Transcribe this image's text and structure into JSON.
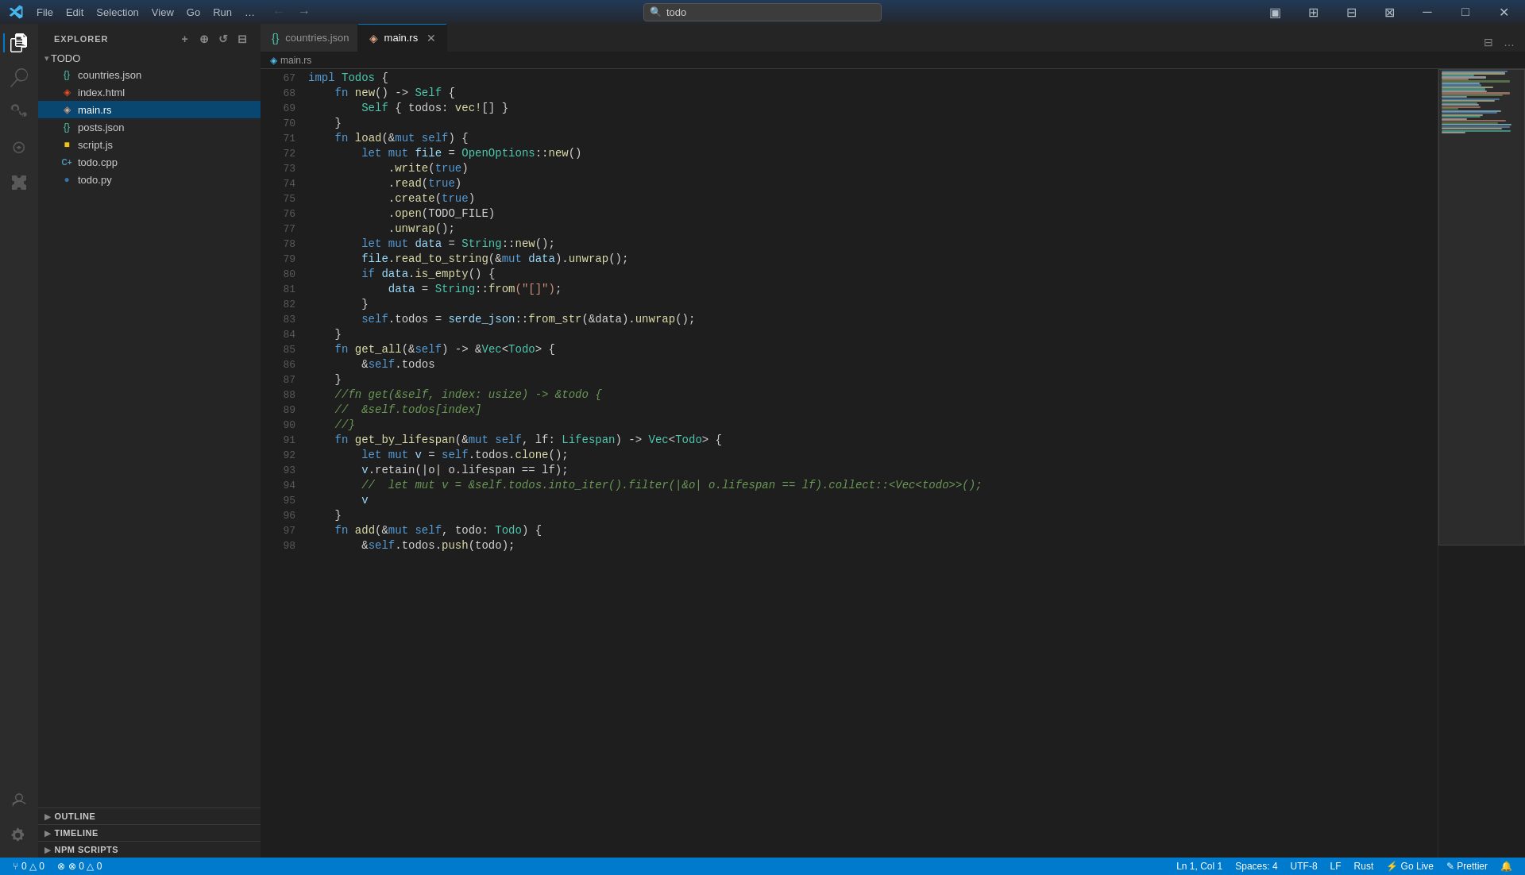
{
  "titlebar": {
    "logo_icon": "◈",
    "menu_items": [
      "File",
      "Edit",
      "Selection",
      "View",
      "Go",
      "Run",
      "…"
    ],
    "search_placeholder": "todo",
    "search_text": "todo",
    "back_btn": "←",
    "forward_btn": "→",
    "win_toggle": "▣",
    "win_split": "⊞",
    "win_split2": "⊟",
    "win_layout": "⊠",
    "minimize": "─",
    "maximize": "□",
    "close": "✕"
  },
  "activity_bar": {
    "icons": [
      {
        "name": "explorer-icon",
        "symbol": "⧉",
        "active": true
      },
      {
        "name": "search-icon",
        "symbol": "🔍",
        "active": false
      },
      {
        "name": "source-control-icon",
        "symbol": "⑂",
        "active": false
      },
      {
        "name": "debug-icon",
        "symbol": "▷",
        "active": false
      },
      {
        "name": "extensions-icon",
        "symbol": "⊞",
        "active": false
      }
    ],
    "bottom_icons": [
      {
        "name": "account-icon",
        "symbol": "👤"
      },
      {
        "name": "settings-icon",
        "symbol": "⚙"
      }
    ]
  },
  "sidebar": {
    "header": "EXPLORER",
    "folder_name": "TODO",
    "files": [
      {
        "name": "countries.json",
        "icon": "{}",
        "icon_color": "#4ec9b0",
        "active": false
      },
      {
        "name": "index.html",
        "icon": "◈",
        "icon_color": "#e44d26",
        "active": false
      },
      {
        "name": "main.rs",
        "icon": "◈",
        "icon_color": "#dea584",
        "active": true
      },
      {
        "name": "posts.json",
        "icon": "{}",
        "icon_color": "#4ec9b0",
        "active": false
      },
      {
        "name": "script.js",
        "icon": "■",
        "icon_color": "#f1c40f",
        "active": false
      },
      {
        "name": "todo.cpp",
        "icon": "C+",
        "icon_color": "#519aba",
        "active": false
      },
      {
        "name": "todo.py",
        "icon": "●",
        "icon_color": "#3572A5",
        "active": false
      }
    ],
    "sections": [
      {
        "label": "OUTLINE",
        "expanded": false
      },
      {
        "label": "TIMELINE",
        "expanded": false
      },
      {
        "label": "NPM SCRIPTS",
        "expanded": false
      }
    ]
  },
  "tabs": [
    {
      "label": "countries.json",
      "icon": "{}",
      "icon_color": "#4ec9b0",
      "active": false,
      "modified": false
    },
    {
      "label": "main.rs",
      "icon": "◈",
      "icon_color": "#dea584",
      "active": true,
      "modified": false
    }
  ],
  "breadcrumb": {
    "path": "main.rs"
  },
  "editor": {
    "lines": [
      {
        "num": 67,
        "content": [
          {
            "text": "impl ",
            "cls": "impl-kw"
          },
          {
            "text": "Todos",
            "cls": "struct"
          },
          {
            "text": " {",
            "cls": "punc"
          }
        ]
      },
      {
        "num": 68,
        "content": [
          {
            "text": "    ",
            "cls": ""
          },
          {
            "text": "fn ",
            "cls": "kw"
          },
          {
            "text": "new",
            "cls": "fn"
          },
          {
            "text": "() -> ",
            "cls": "punc"
          },
          {
            "text": "Self",
            "cls": "type"
          },
          {
            "text": " {",
            "cls": "punc"
          }
        ]
      },
      {
        "num": 69,
        "content": [
          {
            "text": "        ",
            "cls": ""
          },
          {
            "text": "Self",
            "cls": "type"
          },
          {
            "text": " { todos: ",
            "cls": "punc"
          },
          {
            "text": "vec!",
            "cls": "macro"
          },
          {
            "text": "[] }",
            "cls": "punc"
          }
        ]
      },
      {
        "num": 70,
        "content": [
          {
            "text": "    }",
            "cls": "punc"
          }
        ]
      },
      {
        "num": 71,
        "content": [
          {
            "text": "    ",
            "cls": ""
          },
          {
            "text": "fn ",
            "cls": "kw"
          },
          {
            "text": "load",
            "cls": "fn"
          },
          {
            "text": "(&",
            "cls": "punc"
          },
          {
            "text": "mut ",
            "cls": "kw"
          },
          {
            "text": "self",
            "cls": "self-kw"
          },
          {
            "text": ") {",
            "cls": "punc"
          }
        ]
      },
      {
        "num": 72,
        "content": [
          {
            "text": "        ",
            "cls": ""
          },
          {
            "text": "let ",
            "cls": "kw"
          },
          {
            "text": "mut ",
            "cls": "kw"
          },
          {
            "text": "file",
            "cls": "param"
          },
          {
            "text": " = ",
            "cls": "op"
          },
          {
            "text": "OpenOptions",
            "cls": "type"
          },
          {
            "text": "::",
            "cls": "punc"
          },
          {
            "text": "new",
            "cls": "fn"
          },
          {
            "text": "()",
            "cls": "punc"
          }
        ]
      },
      {
        "num": 73,
        "content": [
          {
            "text": "            .",
            "cls": "punc"
          },
          {
            "text": "write",
            "cls": "method"
          },
          {
            "text": "(",
            "cls": "punc"
          },
          {
            "text": "true",
            "cls": "bool"
          },
          {
            "text": ")",
            "cls": "punc"
          }
        ]
      },
      {
        "num": 74,
        "content": [
          {
            "text": "            .",
            "cls": "punc"
          },
          {
            "text": "read",
            "cls": "method"
          },
          {
            "text": "(",
            "cls": "punc"
          },
          {
            "text": "true",
            "cls": "bool"
          },
          {
            "text": ")",
            "cls": "punc"
          }
        ]
      },
      {
        "num": 75,
        "content": [
          {
            "text": "            .",
            "cls": "punc"
          },
          {
            "text": "create",
            "cls": "method"
          },
          {
            "text": "(",
            "cls": "punc"
          },
          {
            "text": "true",
            "cls": "bool"
          },
          {
            "text": ")",
            "cls": "punc"
          }
        ]
      },
      {
        "num": 76,
        "content": [
          {
            "text": "            .",
            "cls": "punc"
          },
          {
            "text": "open",
            "cls": "method"
          },
          {
            "text": "(TODO_FILE)",
            "cls": "punc"
          }
        ]
      },
      {
        "num": 77,
        "content": [
          {
            "text": "            .",
            "cls": "punc"
          },
          {
            "text": "unwrap",
            "cls": "method"
          },
          {
            "text": "();",
            "cls": "punc"
          }
        ]
      },
      {
        "num": 78,
        "content": [
          {
            "text": "        ",
            "cls": ""
          },
          {
            "text": "let ",
            "cls": "kw"
          },
          {
            "text": "mut ",
            "cls": "kw"
          },
          {
            "text": "data",
            "cls": "param"
          },
          {
            "text": " = ",
            "cls": "op"
          },
          {
            "text": "String",
            "cls": "type"
          },
          {
            "text": "::",
            "cls": "punc"
          },
          {
            "text": "new",
            "cls": "fn"
          },
          {
            "text": "();",
            "cls": "punc"
          }
        ]
      },
      {
        "num": 79,
        "content": [
          {
            "text": "        ",
            "cls": ""
          },
          {
            "text": "file",
            "cls": "param"
          },
          {
            "text": ".",
            "cls": "punc"
          },
          {
            "text": "read_to_string",
            "cls": "method"
          },
          {
            "text": "(&",
            "cls": "punc"
          },
          {
            "text": "mut ",
            "cls": "kw"
          },
          {
            "text": "data",
            "cls": "param"
          },
          {
            "text": ").",
            "cls": "punc"
          },
          {
            "text": "unwrap",
            "cls": "method"
          },
          {
            "text": "();",
            "cls": "punc"
          }
        ]
      },
      {
        "num": 80,
        "content": [
          {
            "text": "        ",
            "cls": ""
          },
          {
            "text": "if ",
            "cls": "kw"
          },
          {
            "text": "data",
            "cls": "param"
          },
          {
            "text": ".",
            "cls": "punc"
          },
          {
            "text": "is_empty",
            "cls": "method"
          },
          {
            "text": "() {",
            "cls": "punc"
          }
        ]
      },
      {
        "num": 81,
        "content": [
          {
            "text": "            ",
            "cls": ""
          },
          {
            "text": "data",
            "cls": "param"
          },
          {
            "text": " = ",
            "cls": "op"
          },
          {
            "text": "String",
            "cls": "type"
          },
          {
            "text": "::",
            "cls": "punc"
          },
          {
            "text": "from",
            "cls": "fn"
          },
          {
            "text": "(\"[]\")",
            "cls": "str"
          },
          {
            "text": ";",
            "cls": "punc"
          }
        ]
      },
      {
        "num": 82,
        "content": [
          {
            "text": "        }",
            "cls": "punc"
          }
        ]
      },
      {
        "num": 83,
        "content": [
          {
            "text": "        ",
            "cls": ""
          },
          {
            "text": "self",
            "cls": "self-kw"
          },
          {
            "text": ".todos = ",
            "cls": "punc"
          },
          {
            "text": "serde_json",
            "cls": "param"
          },
          {
            "text": "::",
            "cls": "punc"
          },
          {
            "text": "from_str",
            "cls": "fn"
          },
          {
            "text": "(&data).",
            "cls": "punc"
          },
          {
            "text": "unwrap",
            "cls": "method"
          },
          {
            "text": "();",
            "cls": "punc"
          }
        ]
      },
      {
        "num": 84,
        "content": [
          {
            "text": "    }",
            "cls": "punc"
          }
        ]
      },
      {
        "num": 85,
        "content": [
          {
            "text": "    ",
            "cls": ""
          },
          {
            "text": "fn ",
            "cls": "kw"
          },
          {
            "text": "get_all",
            "cls": "fn"
          },
          {
            "text": "(&",
            "cls": "punc"
          },
          {
            "text": "self",
            "cls": "self-kw"
          },
          {
            "text": ") -> &",
            "cls": "punc"
          },
          {
            "text": "Vec",
            "cls": "type"
          },
          {
            "text": "<",
            "cls": "punc"
          },
          {
            "text": "Todo",
            "cls": "type"
          },
          {
            "text": "> {",
            "cls": "punc"
          }
        ]
      },
      {
        "num": 86,
        "content": [
          {
            "text": "        &",
            "cls": "punc"
          },
          {
            "text": "self",
            "cls": "self-kw"
          },
          {
            "text": ".todos",
            "cls": "punc"
          }
        ]
      },
      {
        "num": 87,
        "content": [
          {
            "text": "    }",
            "cls": "punc"
          }
        ]
      },
      {
        "num": 88,
        "content": [
          {
            "text": "    //fn get(&self, index: usize) -> &todo {",
            "cls": "comment"
          }
        ]
      },
      {
        "num": 89,
        "content": [
          {
            "text": "    //  &self.todos[index]",
            "cls": "comment"
          }
        ]
      },
      {
        "num": 90,
        "content": [
          {
            "text": "    //}",
            "cls": "comment"
          }
        ]
      },
      {
        "num": 91,
        "content": [
          {
            "text": "    ",
            "cls": ""
          },
          {
            "text": "fn ",
            "cls": "kw"
          },
          {
            "text": "get_by_lifespan",
            "cls": "fn"
          },
          {
            "text": "(&",
            "cls": "punc"
          },
          {
            "text": "mut ",
            "cls": "kw"
          },
          {
            "text": "self",
            "cls": "self-kw"
          },
          {
            "text": ", lf: ",
            "cls": "punc"
          },
          {
            "text": "Lifespan",
            "cls": "type"
          },
          {
            "text": ") -> ",
            "cls": "punc"
          },
          {
            "text": "Vec",
            "cls": "type"
          },
          {
            "text": "<",
            "cls": "punc"
          },
          {
            "text": "Todo",
            "cls": "type"
          },
          {
            "text": "> {",
            "cls": "punc"
          }
        ]
      },
      {
        "num": 92,
        "content": [
          {
            "text": "        ",
            "cls": ""
          },
          {
            "text": "let ",
            "cls": "kw"
          },
          {
            "text": "mut ",
            "cls": "kw"
          },
          {
            "text": "v",
            "cls": "param"
          },
          {
            "text": " = ",
            "cls": "op"
          },
          {
            "text": "self",
            "cls": "self-kw"
          },
          {
            "text": ".todos.",
            "cls": "punc"
          },
          {
            "text": "clone",
            "cls": "method"
          },
          {
            "text": "();",
            "cls": "punc"
          }
        ]
      },
      {
        "num": 93,
        "content": [
          {
            "text": "        ",
            "cls": ""
          },
          {
            "text": "v",
            "cls": "param"
          },
          {
            "text": ".retain(|o| o.lifespan == lf);",
            "cls": "punc"
          }
        ]
      },
      {
        "num": 94,
        "content": [
          {
            "text": "        //  let mut v = &self.todos.into_iter().filter(|&o| o.lifespan == lf).collect::<Vec<todo>>();",
            "cls": "comment"
          }
        ]
      },
      {
        "num": 95,
        "content": [
          {
            "text": "        v",
            "cls": "param"
          }
        ]
      },
      {
        "num": 96,
        "content": [
          {
            "text": "    }",
            "cls": "punc"
          }
        ]
      },
      {
        "num": 97,
        "content": [
          {
            "text": "    ",
            "cls": ""
          },
          {
            "text": "fn ",
            "cls": "kw"
          },
          {
            "text": "add",
            "cls": "fn"
          },
          {
            "text": "(&",
            "cls": "punc"
          },
          {
            "text": "mut ",
            "cls": "kw"
          },
          {
            "text": "self",
            "cls": "self-kw"
          },
          {
            "text": ", todo: ",
            "cls": "punc"
          },
          {
            "text": "Todo",
            "cls": "type"
          },
          {
            "text": ") {",
            "cls": "punc"
          }
        ]
      },
      {
        "num": 98,
        "content": [
          {
            "text": "        &",
            "cls": "punc"
          },
          {
            "text": "self",
            "cls": "self-kw"
          },
          {
            "text": ".todos.",
            "cls": "punc"
          },
          {
            "text": "push",
            "cls": "method"
          },
          {
            "text": "(todo);",
            "cls": "punc"
          }
        ]
      }
    ]
  },
  "status_bar": {
    "git_branch": "⑂ 0 △ 0",
    "errors": "⊗ 0 △ 0",
    "notifications": "🔔 0",
    "position": "Ln 1, Col 1",
    "spaces": "Spaces: 4",
    "encoding": "UTF-8",
    "line_ending": "LF",
    "language": "Rust",
    "golive": "⚡ Go Live",
    "prettier": "✎ Prettier",
    "bell": "🔔"
  }
}
